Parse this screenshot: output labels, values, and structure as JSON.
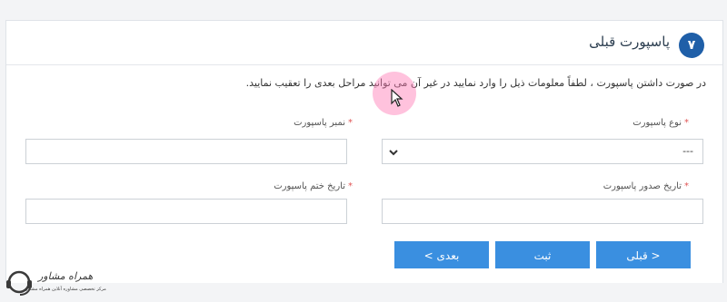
{
  "section": {
    "step_number": "۷",
    "title": "پاسپورت قبلی",
    "info_text": "در صورت داشتن پاسپورت ، لطفاً معلومات ذیل را وارد نمایید در غیر آن می توانید مراحل بعدی را تعقیب نمایید."
  },
  "form": {
    "passport_type": {
      "label": "نوع پاسپورت",
      "value": "---"
    },
    "passport_number": {
      "label": "نمبر پاسپورت",
      "value": ""
    },
    "issue_date": {
      "label": "تاریخ صدور پاسپورت",
      "value": ""
    },
    "expiry_date": {
      "label": "تاریخ ختم پاسپورت",
      "value": ""
    },
    "required_mark": "*"
  },
  "buttons": {
    "previous": "< قبلی",
    "save": "ثبت",
    "next": "بعدی >"
  },
  "watermark": {
    "name": "همراه مشاور",
    "tagline": "مرکز تخصصی مشاوره آنلاین همراه مشاور"
  },
  "colors": {
    "primary": "#3a8fe0",
    "badge": "#1f5fa8",
    "required": "#e05555"
  }
}
